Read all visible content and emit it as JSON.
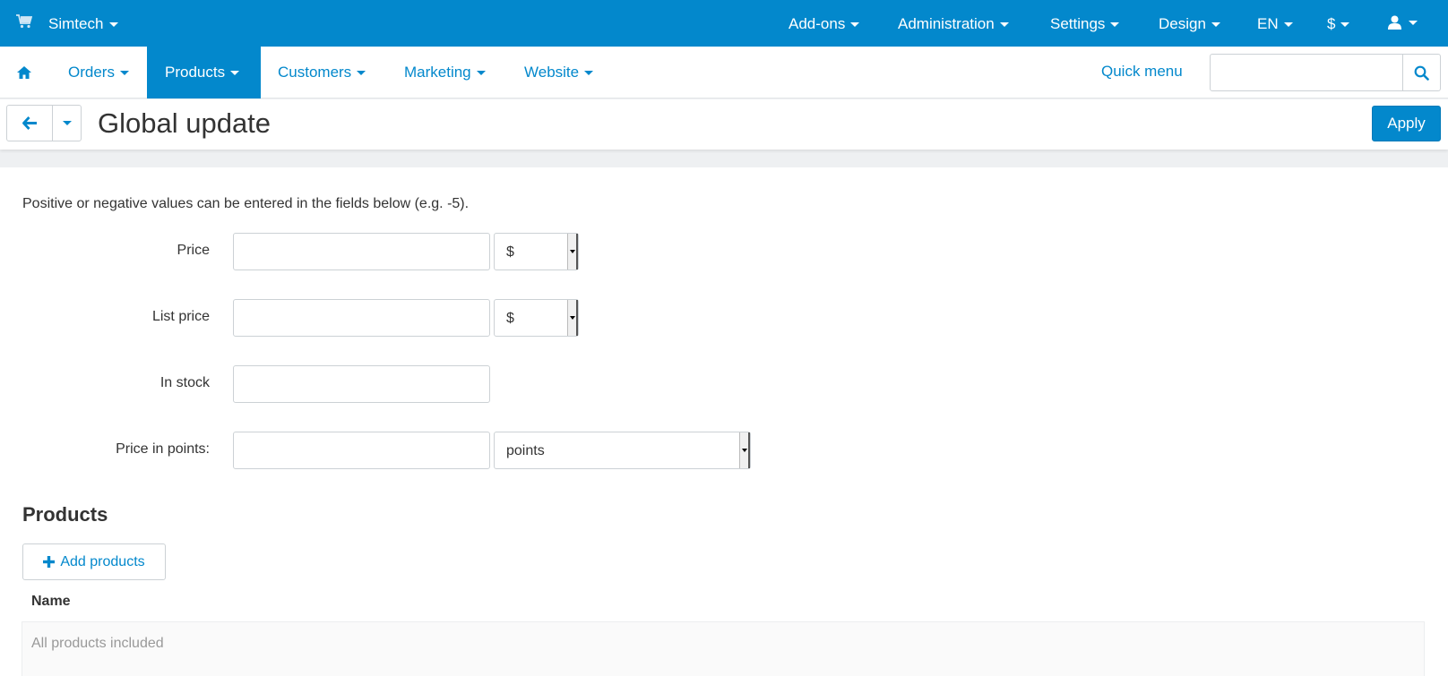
{
  "colors": {
    "brand": "#0388cc",
    "text": "#333333",
    "muted": "#999999"
  },
  "topbar": {
    "store": "Simtech",
    "items": [
      {
        "label": "Add-ons"
      },
      {
        "label": "Administration"
      },
      {
        "label": "Settings"
      },
      {
        "label": "Design"
      },
      {
        "label": "EN"
      },
      {
        "label": "$"
      }
    ],
    "icons": [
      "cart-icon",
      "user-icon"
    ]
  },
  "mainnav": {
    "items": [
      {
        "label": "Orders"
      },
      {
        "label": "Products",
        "active": true
      },
      {
        "label": "Customers"
      },
      {
        "label": "Marketing"
      },
      {
        "label": "Website"
      }
    ],
    "quick_menu": "Quick menu",
    "search": {
      "value": "",
      "placeholder": ""
    }
  },
  "toolbar": {
    "title": "Global update",
    "apply_label": "Apply"
  },
  "form": {
    "hint": "Positive or negative values can be entered in the fields below (e.g. -5).",
    "price": {
      "label": "Price",
      "value": "",
      "unit": "$"
    },
    "list_price": {
      "label": "List price",
      "value": "",
      "unit": "$"
    },
    "in_stock": {
      "label": "In stock",
      "value": ""
    },
    "price_points": {
      "label": "Price in points:",
      "value": "",
      "unit": "points"
    }
  },
  "products": {
    "heading": "Products",
    "add_label": "Add products",
    "column_name": "Name",
    "empty_text": "All products included"
  }
}
